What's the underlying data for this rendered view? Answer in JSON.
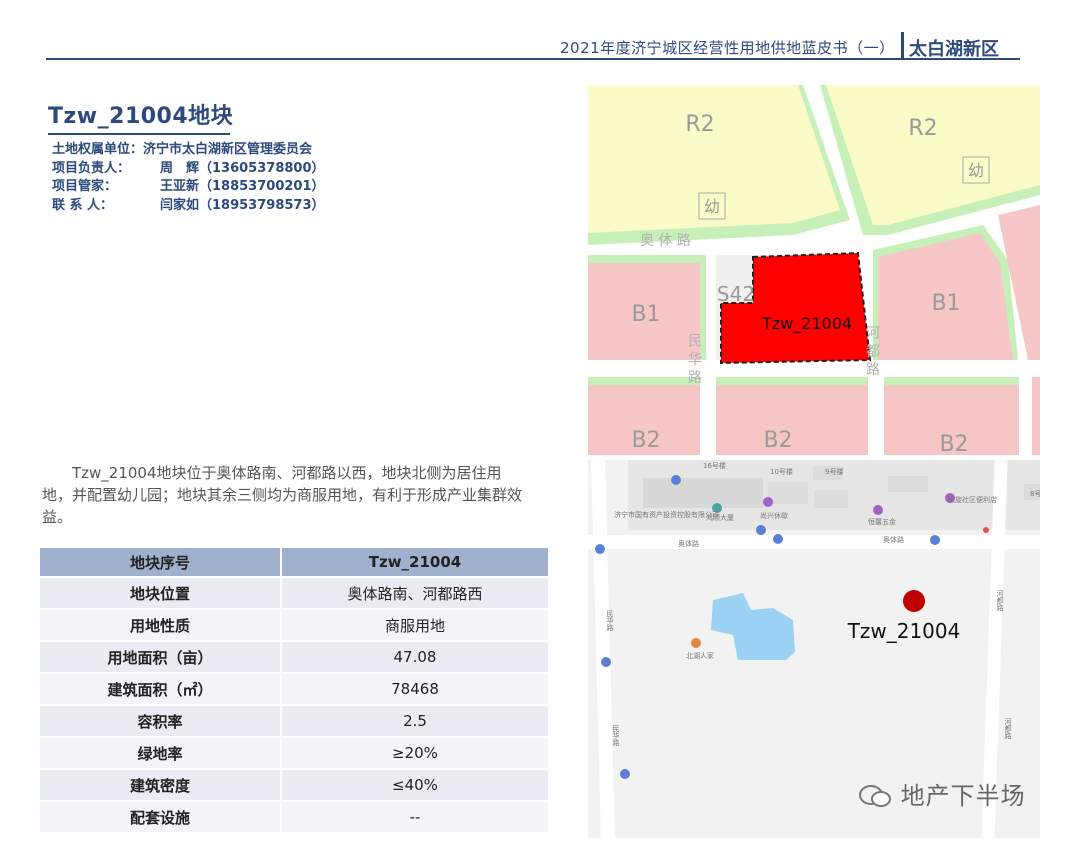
{
  "header": {
    "title": "2021年度济宁城区经营性用地供地蓝皮书（一）",
    "area": "太白湖新区"
  },
  "plot": {
    "title": "Tzw_21004地块",
    "info": [
      {
        "key": "土地权属单位：",
        "value": "济宁市太白湖新区管理委员会"
      },
      {
        "key": "项目负责人：",
        "value": "周　辉（13605378800）"
      },
      {
        "key": "项目管家：",
        "value": "王亚新（18853700201）"
      },
      {
        "key": "联 系 人：",
        "value": "闫家如（18953798573）"
      }
    ],
    "description": "Tzw_21004地块位于奥体路南、河都路以西，地块北侧为居住用地，并配置幼儿园；地块其余三侧均为商服用地，有利于形成产业集群效益。"
  },
  "table": {
    "header": {
      "key": "地块序号",
      "value": "Tzw_21004"
    },
    "rows": [
      {
        "key": "地块位置",
        "value": "奥体路南、河都路西"
      },
      {
        "key": "用地性质",
        "value": "商服用地"
      },
      {
        "key": "用地面积（亩）",
        "value": "47.08"
      },
      {
        "key": "建筑面积（㎡）",
        "value": "78468"
      },
      {
        "key": "容积率",
        "value": "2.5"
      },
      {
        "key": "绿地率",
        "value": "≥20%"
      },
      {
        "key": "建筑密度",
        "value": "≤40%"
      },
      {
        "key": "配套设施",
        "value": "--"
      }
    ]
  },
  "zoning_map": {
    "zones": {
      "r2_left": "R2",
      "r2_right": "R2",
      "kinder_1": "幼",
      "kinder_2": "幼",
      "b1_left": "B1",
      "b1_right": "B1",
      "b2_left": "B2",
      "b2_mid": "B2",
      "b2_right": "B2",
      "s42": "S42"
    },
    "roads": {
      "aoti": "奥 体 路",
      "minhua": "民 华 路",
      "hedu": "河 都 路"
    },
    "parcel_label": "Tzw_21004",
    "colors": {
      "residential": "#fbfbc8",
      "commercial": "#f7c6c6",
      "green": "#c6f0b8",
      "parcel": "#ff0000",
      "road": "#ffffff"
    }
  },
  "location_map": {
    "labels": {
      "b16": "16号楼",
      "b10": "10号楼",
      "b9": "9号楼",
      "b8": "8号楼",
      "guoyou": "济宁市国有资产投资控股有限公司",
      "honghui": "鸿顺大厦",
      "yuxing": "尚兴休歇",
      "hengfeng": "恒馨五金",
      "shequ": "凯旋社区便利店",
      "aoti1": "奥体路",
      "aoti2": "奥体路",
      "minhua1": "民华路",
      "minhua2": "民华路",
      "hedu1": "河都路",
      "hedu2": "河都路",
      "beihu": "北湖人家"
    },
    "marker_label": "Tzw_21004",
    "marker_color": "#c00000"
  },
  "watermark": "地产下半场"
}
